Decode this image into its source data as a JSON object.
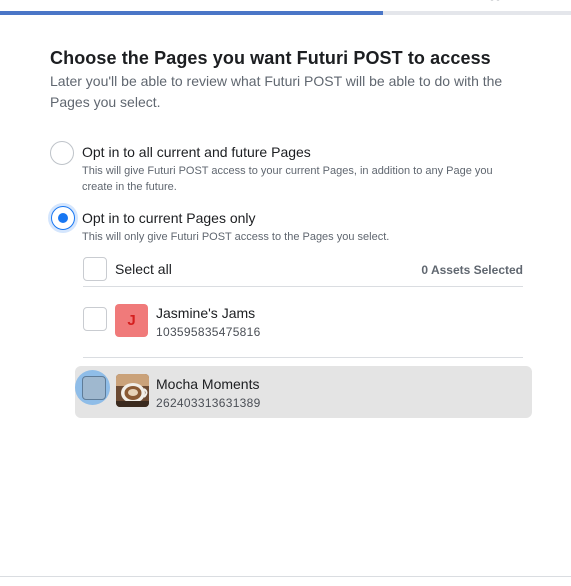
{
  "progress": {
    "fraction": 0.67
  },
  "header": {
    "title": "Choose the Pages you want Futuri POST to access",
    "subtitle": "Later you'll be able to review what Futuri POST will be able to do with the Pages you select."
  },
  "options": [
    {
      "label": "Opt in to all current and future Pages",
      "description": "This will give Futuri POST access to your current Pages, in addition to any Page you create in the future.",
      "selected": false
    },
    {
      "label": "Opt in to current Pages only",
      "description": "This will only give Futuri POST access to the Pages you select.",
      "selected": true
    }
  ],
  "select_all": {
    "label": "Select all",
    "assets_selected": "0 Assets Selected"
  },
  "pages": [
    {
      "initial": "J",
      "name": "Jasmine's Jams",
      "id": "103595835475816",
      "avatar_color": "#f07a7a",
      "checked": false
    },
    {
      "name": "Mocha Moments",
      "id": "262403313631389",
      "avatar_icon": "coffee-cup-photo",
      "checked": false
    }
  ],
  "colors": {
    "accent": "#1877f2",
    "progress": "#4a76c7"
  }
}
